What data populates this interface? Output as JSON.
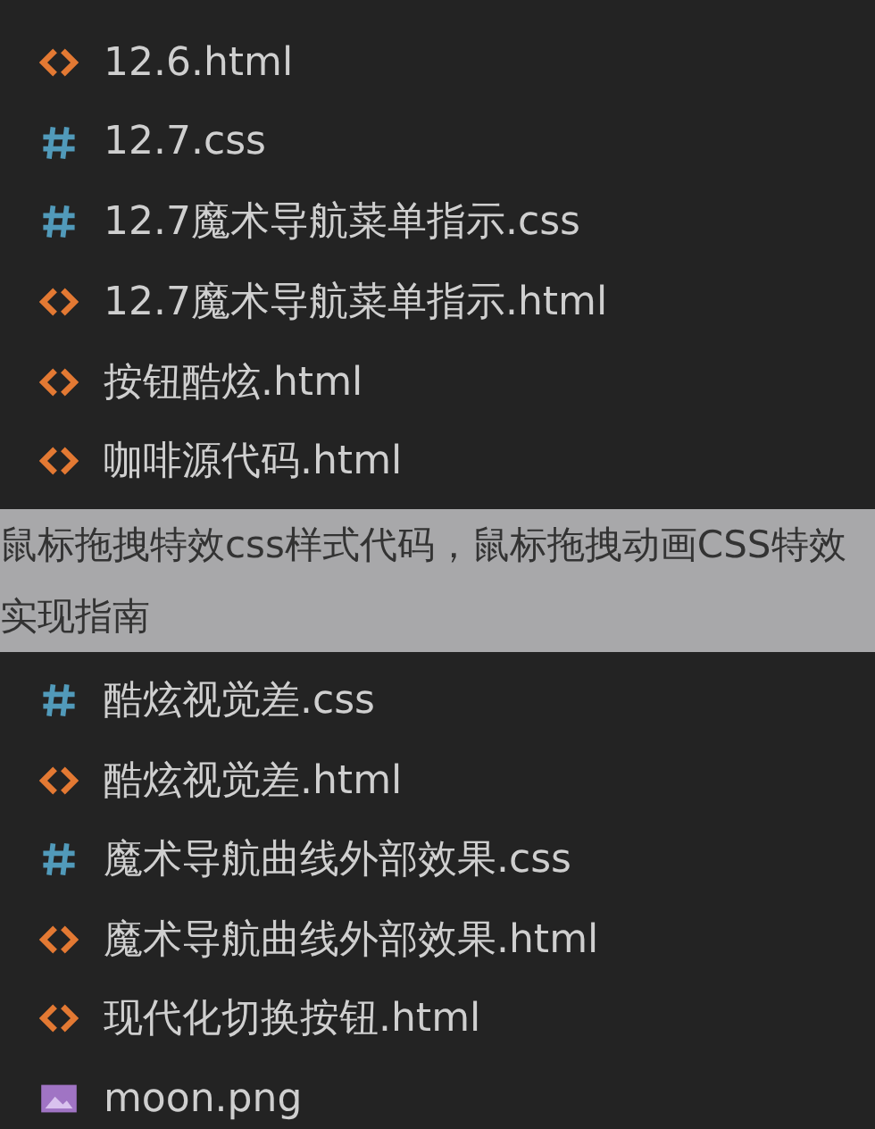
{
  "files_before": [
    {
      "name": "12.6.html",
      "kind": "html"
    },
    {
      "name": "12.7.css",
      "kind": "css"
    },
    {
      "name": "12.7魔术导航菜单指示.css",
      "kind": "css"
    },
    {
      "name": "12.7魔术导航菜单指示.html",
      "kind": "html"
    },
    {
      "name": "按钮酷炫.html",
      "kind": "html"
    },
    {
      "name": "咖啡源代码.html",
      "kind": "html"
    }
  ],
  "caption": "鼠标拖拽特效css样式代码，鼠标拖拽动画CSS特效实现指南",
  "files_after": [
    {
      "name": "酷炫视觉差.css",
      "kind": "css"
    },
    {
      "name": "酷炫视觉差.html",
      "kind": "html"
    },
    {
      "name": "魔术导航曲线外部效果.css",
      "kind": "css"
    },
    {
      "name": "魔术导航曲线外部效果.html",
      "kind": "html"
    },
    {
      "name": "现代化切换按钮.html",
      "kind": "html"
    },
    {
      "name": "moon.png",
      "kind": "image"
    }
  ]
}
